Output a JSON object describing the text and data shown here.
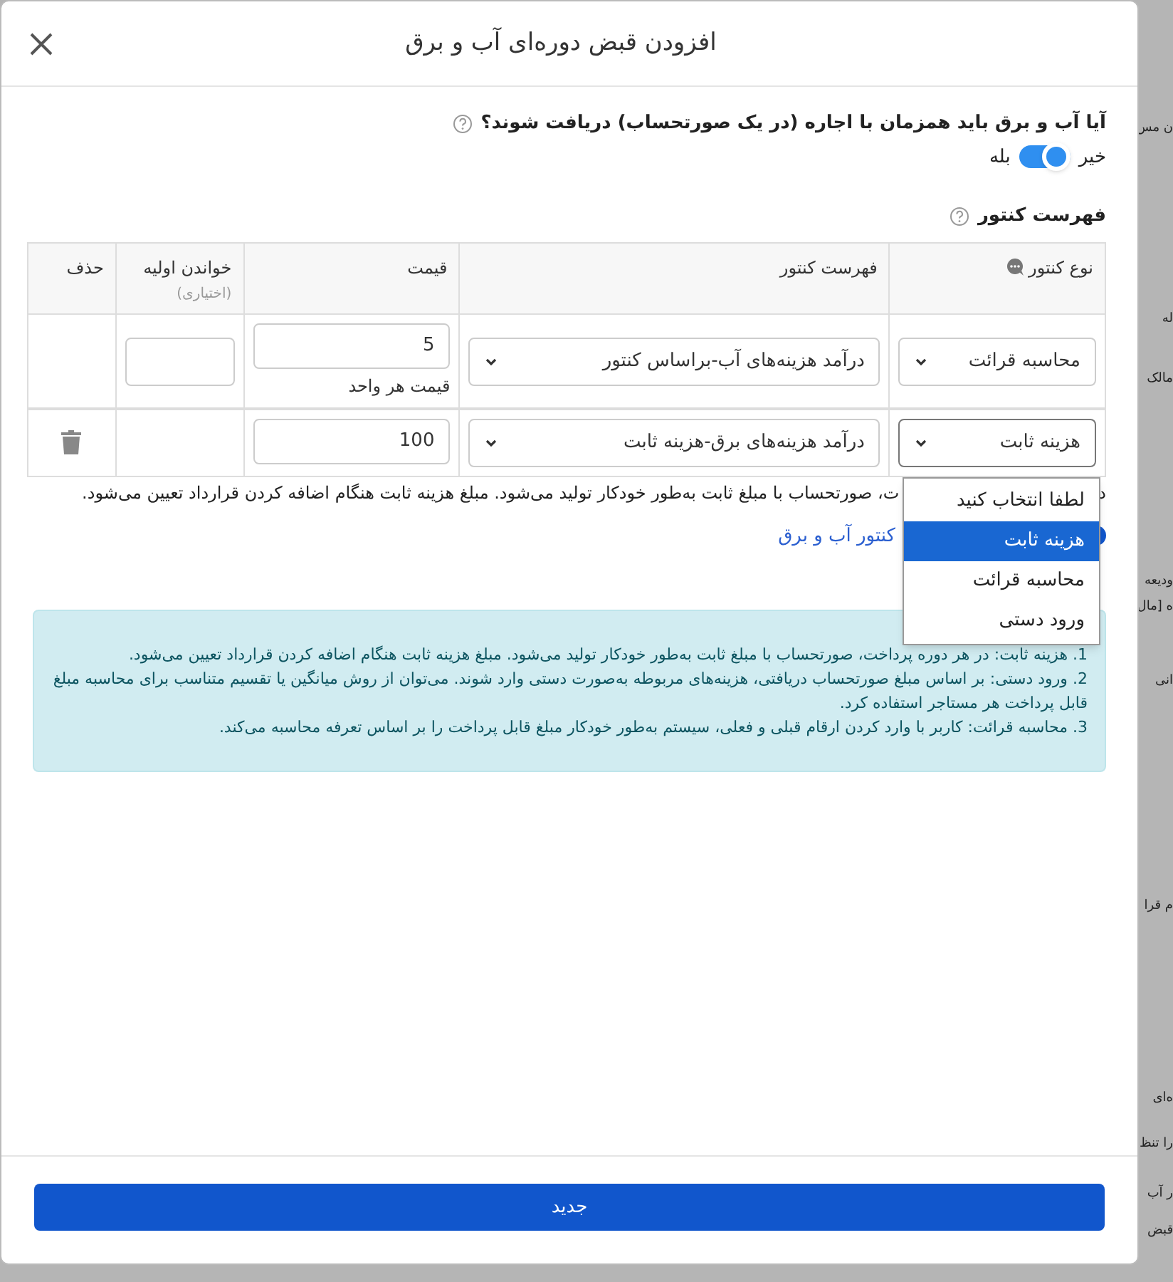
{
  "dialog": {
    "title": "افزودن قبض دوره‌ای آب و برق"
  },
  "question": {
    "text": "آیا آب و برق باید همزمان با اجاره (در یک صورتحساب) دریافت شوند؟",
    "off_label": "خیر",
    "on_label": "بله",
    "on": true
  },
  "meters": {
    "title": "فهرست کنتور",
    "columns": [
      {
        "label": "نوع کنتور"
      },
      {
        "label": "فهرست کنتور"
      },
      {
        "label": "قیمت"
      },
      {
        "label": "خواندن اولیه",
        "hint": "(اختیاری)"
      },
      {
        "label": "حذف"
      }
    ],
    "rows": [
      {
        "type": "محاسبه قرائت",
        "meter": "درآمد هزینه‌های آب-براساس کنتور",
        "price": "5",
        "price_caption": "قیمت هر واحد",
        "reading_field": true,
        "deletable": false,
        "focused": false
      },
      {
        "type": "هزینه ثابت",
        "meter": "درآمد هزینه‌های برق-هزینه ثابت",
        "price": "100",
        "reading_field": false,
        "deletable": true,
        "focused": true
      }
    ]
  },
  "note": {
    "fragment": "د",
    "text": "ت، صورتحساب با مبلغ ثابت به‌طور خودکار تولید می‌شود. مبلغ هزینه ثابت هنگام اضافه کردن قرارداد تعیین می‌شود."
  },
  "add_link": {
    "text": "کنتور آب و برق"
  },
  "dropdown": {
    "options": [
      {
        "label": "لطفا انتخاب کنید",
        "selected": false
      },
      {
        "label": "هزینه ثابت",
        "selected": true
      },
      {
        "label": "محاسبه قرائت",
        "selected": false
      },
      {
        "label": "ورود دستی",
        "selected": false
      }
    ]
  },
  "info": {
    "items": [
      "1. هزینه ثابت: در هر دوره پرداخت، صورتحساب با مبلغ ثابت به‌طور خودکار تولید می‌شود. مبلغ هزینه ثابت هنگام اضافه کردن قرارداد تعیین می‌شود.",
      "2. ورود دستی: بر اساس مبلغ صورتحساب دریافتی، هزینه‌های مربوطه به‌صورت دستی وارد شوند. می‌توان از روش میانگین یا تقسیم متناسب برای محاسبه مبلغ قابل پرداخت هر مستاجر استفاده کرد.",
      "3. محاسبه قرائت: کاربر با وارد کردن ارقام قبلی و فعلی، سیستم به‌طور خودکار مبلغ قابل پرداخت را بر اساس تعرفه محاسبه می‌کند."
    ]
  },
  "footer": {
    "button": "جدید"
  },
  "background": {
    "fragments": [
      "ن مس",
      "له",
      "مالک",
      "ودیعه",
      "ه [مال",
      "انی",
      "م قرا",
      "ه‌ای",
      "را تنظ",
      "ر آب",
      "قبض"
    ]
  }
}
